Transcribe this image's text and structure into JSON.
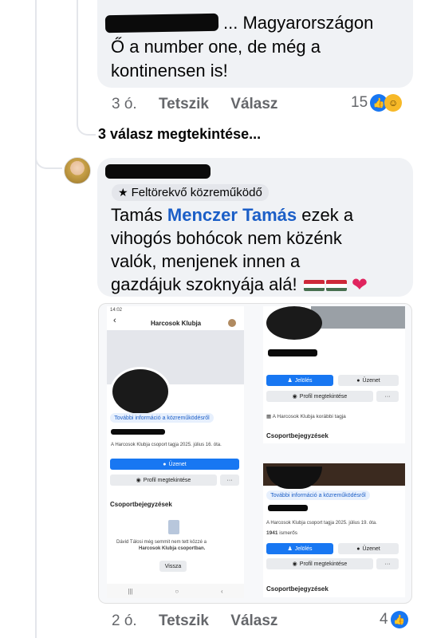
{
  "comment1": {
    "text_suffix": "... Magyarországon",
    "line2": "Ő a number one, de még a",
    "line3": "kontinensen is!",
    "time": "3 ó.",
    "like_action": "Tetszik",
    "reply_action": "Válasz",
    "reaction_count": "15",
    "more_replies": "3 válasz megtekintése..."
  },
  "comment2": {
    "badge": "Feltörekvő közreműködő",
    "mention_prefix": "Tamás",
    "mention_name": "Menczer Tamás",
    "line1_rest": "ezek a",
    "line2": "vihogós bohócok nem közénk",
    "line3": "valók,  menjenek innen a",
    "line4": "gazdájuk szoknyája alá!",
    "time": "2 ó.",
    "like_action": "Tetszik",
    "reply_action": "Válasz",
    "reaction_count": "4"
  },
  "screenshot": {
    "status_time": "14:02",
    "group_title": "Harcosok Klubja",
    "more_info_left": "További információ a közreműködésről",
    "member_since_left": "A Harcosok Klubja csoport tagja 2025. július 16. óta.",
    "message_btn": "Üzenet",
    "profile_btn": "Profil megtekintése",
    "more_btn": "···",
    "section_title": "Csoportbejegyzések",
    "empty_text": "Dávid Tálosi még semmit nem tett közzé a",
    "empty_text2": "Harcosok Klubja csoportban.",
    "back_btn": "Vissza",
    "right_mark_btn": "Jelölés",
    "right_message_btn": "Üzenet",
    "right_profile_btn": "Profil megtekintése",
    "former_member": "A Harcosok Klubja korábbi tagja",
    "section_title_right": "Csoportbejegyzések",
    "more_info_right": "További információ a közreműködésről",
    "member_since_right": "A Harcosok Klubja csoport tagja 2025. július 19. óta.",
    "friends_count": "1941",
    "friends_label": "ismerős",
    "section_title_right2": "Csoportbejegyzések"
  },
  "colors": {
    "accent": "#1877f2",
    "bubble": "#f0f2f5",
    "meta": "#65676b"
  }
}
